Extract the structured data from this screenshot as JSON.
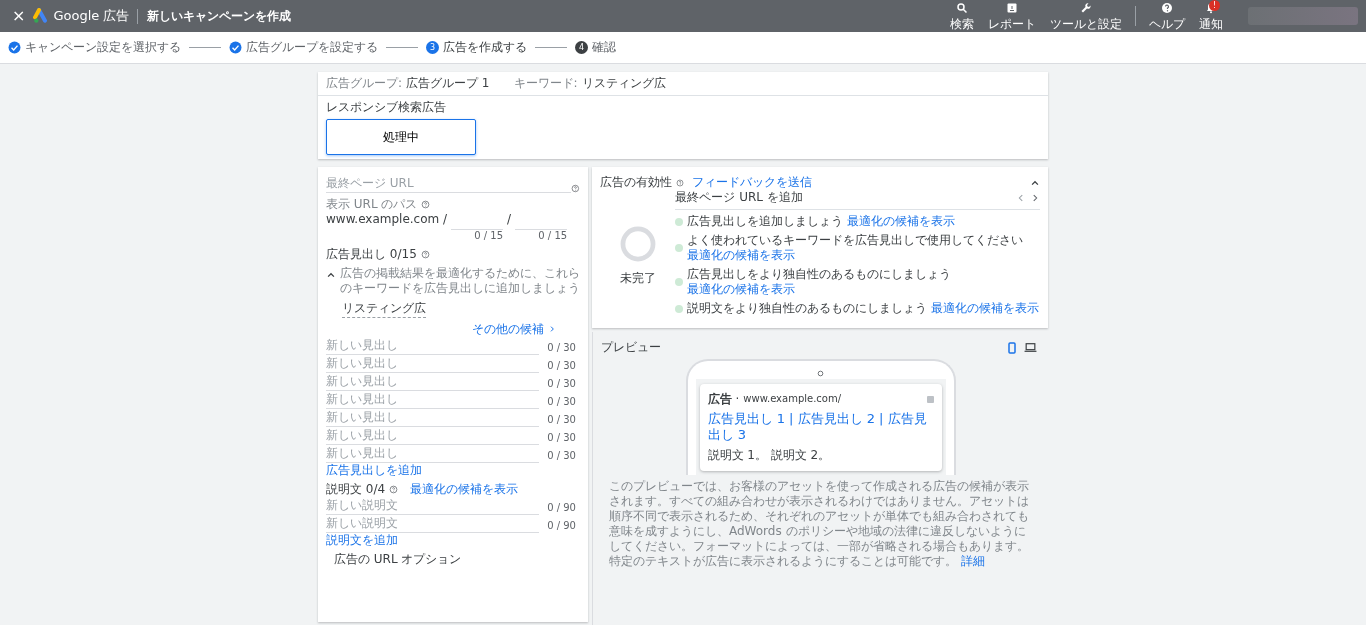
{
  "header": {
    "close": "×",
    "product": "Google 広告",
    "title": "新しいキャンペーンを作成",
    "actions": [
      {
        "kind": "search",
        "label": "検索"
      },
      {
        "kind": "report",
        "label": "レポート"
      },
      {
        "kind": "tools",
        "label": "ツールと設定"
      },
      {
        "kind": "help",
        "label": "ヘルプ"
      },
      {
        "kind": "bell",
        "label": "通知",
        "badge": "!"
      }
    ]
  },
  "steps": [
    {
      "kind": "done",
      "label": "キャンペーン設定を選択する"
    },
    {
      "kind": "done",
      "label": "広告グループを設定する"
    },
    {
      "kind": "current",
      "number": "3",
      "label": "広告を作成する"
    },
    {
      "kind": "pending",
      "number": "4",
      "label": "確認"
    }
  ],
  "context": {
    "ad_group_label": "広告グループ:",
    "ad_group": "広告グループ 1",
    "keyword_label": "キーワード:",
    "keyword": "リスティング広"
  },
  "ad_type": {
    "label": "レスポンシブ検索広告",
    "card": "処理中",
    "selected": true
  },
  "form": {
    "final_url": {
      "placeholder": "最終ページ URL"
    },
    "display_path": {
      "label": "表示 URL のパス",
      "domain": "www.example.com /",
      "separator": "/",
      "counters": [
        "0 / 15",
        "0 / 15"
      ]
    },
    "headlines": {
      "title": "広告見出し 0/15",
      "suggestion": "広告の掲載結果を最適化するために、これらのキーワードを広告見出しに追加しましょう",
      "expanded": true,
      "keywords": [
        "リスティング広"
      ],
      "more": "その他の候補",
      "fields": [
        {
          "placeholder": "新しい見出し",
          "counter": "0 / 30"
        },
        {
          "placeholder": "新しい見出し",
          "counter": "0 / 30"
        },
        {
          "placeholder": "新しい見出し",
          "counter": "0 / 30"
        },
        {
          "placeholder": "新しい見出し",
          "counter": "0 / 30"
        },
        {
          "placeholder": "新しい見出し",
          "counter": "0 / 30"
        },
        {
          "placeholder": "新しい見出し",
          "counter": "0 / 30"
        },
        {
          "placeholder": "新しい見出し",
          "counter": "0 / 30"
        }
      ],
      "add": "広告見出しを追加"
    },
    "descriptions": {
      "title": "説明文 0/4",
      "link": "最適化の候補を表示",
      "fields": [
        {
          "placeholder": "新しい説明文",
          "counter": "0 / 90"
        },
        {
          "placeholder": "新しい説明文",
          "counter": "0 / 90"
        }
      ],
      "add": "説明文を追加"
    },
    "url_options": "広告の URL オプション"
  },
  "ad_strength": {
    "title": "広告の有効性",
    "feedback": "フィードバックを送信",
    "expanded": true,
    "status": "未完了",
    "current_tip": "最終ページ URL を追加",
    "tips": [
      {
        "text": "広告見出しを追加しましょう",
        "link": "最適化の候補を表示"
      },
      {
        "text": "よく使われているキーワードを広告見出しで使用してください",
        "link": "最適化の候補を表示"
      },
      {
        "text": "広告見出しをより独自性のあるものにしましょう",
        "link": "最適化の候補を表示"
      },
      {
        "text": "説明文をより独自性のあるものにしましょう",
        "link": "最適化の候補を表示"
      }
    ]
  },
  "preview": {
    "title": "プレビュー",
    "devices": [
      {
        "kind": "mobile",
        "selected": true
      },
      {
        "kind": "desktop",
        "selected": false
      }
    ],
    "ad": {
      "label": "広告",
      "separator": "·",
      "url": "www.example.com/",
      "headline": "広告見出し 1 | 広告見出し 2 | 広告見出し 3",
      "description": "説明文 1。 説明文 2。"
    },
    "disclaimer": "このプレビューでは、お客様のアセットを使って作成される広告の候補が表示されます。すべての組み合わせが表示されるわけではありません。アセットは順序不同で表示されるため、それぞれのアセットが単体でも組み合わされても意味を成すようにし、AdWords のポリシーや地域の法律に違反しないようにしてください。フォーマットによっては、一部が省略される場合もあります。特定のテキストが広告に表示されるようにすることは可能です。",
    "disclaimer_link": "詳細"
  }
}
